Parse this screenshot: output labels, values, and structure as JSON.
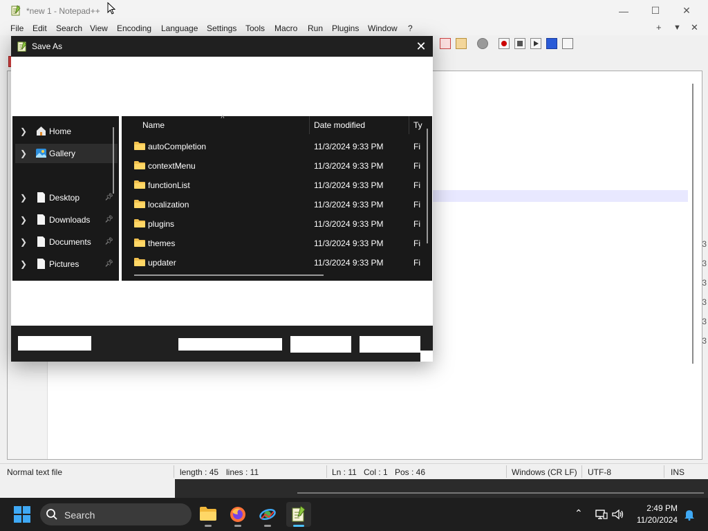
{
  "notepad": {
    "title": "*new 1 - Notepad++",
    "menu": [
      "File",
      "Edit",
      "Search",
      "View",
      "Encoding",
      "Language",
      "Settings",
      "Tools",
      "Macro",
      "Run",
      "Plugins",
      "Window",
      "?"
    ],
    "menu_right": {
      "plus": "+",
      "dropdown": "▼",
      "close": "✕"
    },
    "window_controls": {
      "minimize": "—",
      "maximize": "☐",
      "close": "✕"
    },
    "status": {
      "file_type": "Normal text file",
      "length": "length : 45",
      "lines": "lines : 11",
      "ln": "Ln : 11",
      "col": "Col : 1",
      "pos": "Pos : 46",
      "eol": "Windows (CR LF)",
      "encoding": "UTF-8",
      "mode": "INS"
    },
    "right_edge_marks": [
      "3",
      "3",
      "3",
      "3",
      "3",
      "3"
    ]
  },
  "dialog": {
    "title": "Save As",
    "close": "✕",
    "nav": [
      {
        "label": "Home",
        "icon": "home-icon",
        "pinned": false,
        "selected": false
      },
      {
        "label": "Gallery",
        "icon": "gallery-icon",
        "pinned": false,
        "selected": true
      },
      {
        "label": "Desktop",
        "icon": "document-icon",
        "pinned": true,
        "selected": false
      },
      {
        "label": "Downloads",
        "icon": "document-icon",
        "pinned": true,
        "selected": false
      },
      {
        "label": "Documents",
        "icon": "document-icon",
        "pinned": true,
        "selected": false
      },
      {
        "label": "Pictures",
        "icon": "document-icon",
        "pinned": true,
        "selected": false
      }
    ],
    "columns": {
      "name": "Name",
      "date": "Date modified",
      "type": "Ty"
    },
    "files": [
      {
        "name": "autoCompletion",
        "date": "11/3/2024 9:33 PM",
        "type": "Fi"
      },
      {
        "name": "contextMenu",
        "date": "11/3/2024 9:33 PM",
        "type": "Fi"
      },
      {
        "name": "functionList",
        "date": "11/3/2024 9:33 PM",
        "type": "Fi"
      },
      {
        "name": "localization",
        "date": "11/3/2024 9:33 PM",
        "type": "Fi"
      },
      {
        "name": "plugins",
        "date": "11/3/2024 9:33 PM",
        "type": "Fi"
      },
      {
        "name": "themes",
        "date": "11/3/2024 9:33 PM",
        "type": "Fi"
      },
      {
        "name": "updater",
        "date": "11/3/2024 9:33 PM",
        "type": "Fi"
      }
    ]
  },
  "taskbar": {
    "search_label": "Search",
    "apps": [
      "file-explorer",
      "firefox",
      "network-app",
      "notepad-plus-plus"
    ],
    "active_app": "notepad-plus-plus",
    "tray": {
      "chevron": "⌃",
      "network": "network-icon",
      "volume": "volume-icon",
      "bell": "bell-icon"
    },
    "time": "2:49 PM",
    "date": "11/20/2024"
  },
  "colors": {
    "dialog_dark": "#191919",
    "titlebar_dark": "#202020",
    "taskbar": "#1e1e1e",
    "accent": "#4cc2ff",
    "folder": "#f2c14e"
  }
}
